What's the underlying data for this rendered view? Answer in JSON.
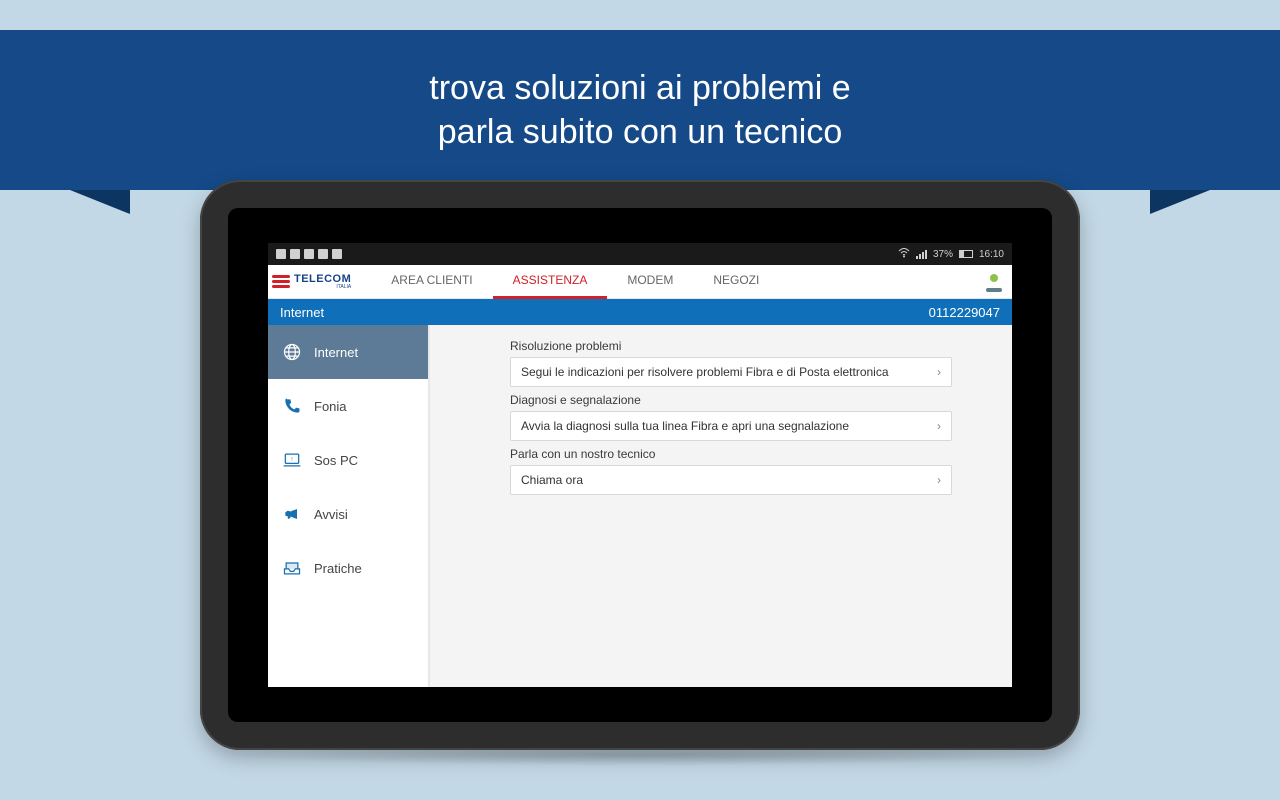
{
  "hero": {
    "line1": "trova soluzioni ai problemi e",
    "line2": "parla subito con un tecnico"
  },
  "status": {
    "battery_pct": "37%",
    "time": "16:10"
  },
  "brand": {
    "name": "TELECOM",
    "sub": "ITALIA"
  },
  "nav": {
    "tabs": [
      {
        "label": "AREA CLIENTI",
        "active": false
      },
      {
        "label": "ASSISTENZA",
        "active": true
      },
      {
        "label": "MODEM",
        "active": false
      },
      {
        "label": "NEGOZI",
        "active": false
      }
    ]
  },
  "crumb": {
    "title": "Internet",
    "account": "0112229047"
  },
  "sidebar": {
    "items": [
      {
        "label": "Internet",
        "icon": "globe-icon",
        "active": true
      },
      {
        "label": "Fonia",
        "icon": "phone-icon",
        "active": false
      },
      {
        "label": "Sos PC",
        "icon": "laptop-icon",
        "active": false
      },
      {
        "label": "Avvisi",
        "icon": "megaphone-icon",
        "active": false
      },
      {
        "label": "Pratiche",
        "icon": "tray-icon",
        "active": false
      }
    ]
  },
  "content": {
    "sections": [
      {
        "label": "Risoluzione problemi",
        "option": "Segui le indicazioni per risolvere problemi Fibra e di Posta elettronica"
      },
      {
        "label": "Diagnosi e segnalazione",
        "option": "Avvia la diagnosi sulla tua linea Fibra e apri una segnalazione"
      },
      {
        "label": "Parla con un nostro tecnico",
        "option": "Chiama ora"
      }
    ]
  }
}
